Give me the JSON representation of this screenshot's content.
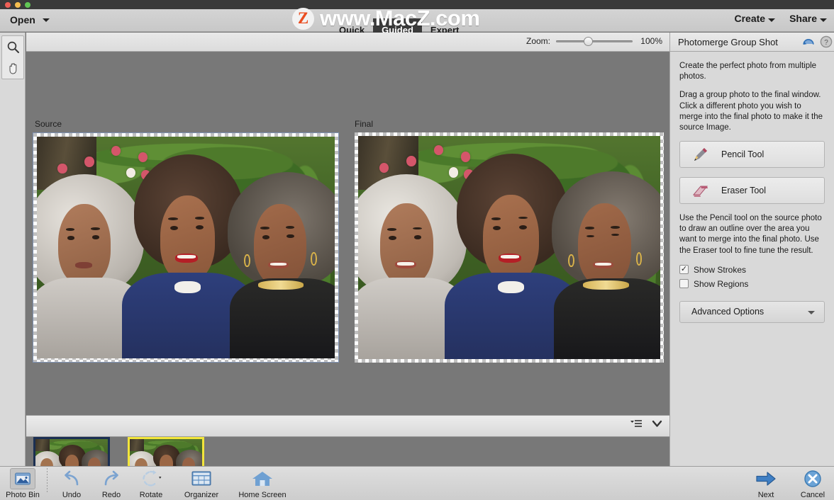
{
  "window": {
    "traffic_lights": [
      "close",
      "minimize",
      "zoom"
    ]
  },
  "menubar": {
    "open_label": "Open",
    "tabs": [
      {
        "label": "Quick",
        "active": false
      },
      {
        "label": "Guided",
        "active": true
      },
      {
        "label": "Expert",
        "active": false
      }
    ],
    "right_menus": [
      {
        "label": "Create"
      },
      {
        "label": "Share"
      }
    ]
  },
  "watermark": {
    "badge": "Z",
    "text": "www.MacZ.com"
  },
  "toolstrip": {
    "tools": [
      {
        "name": "zoom-tool",
        "icon": "magnifier-icon"
      },
      {
        "name": "hand-tool",
        "icon": "hand-icon"
      }
    ]
  },
  "options_bar": {
    "zoom_label": "Zoom:",
    "zoom_value": "100%",
    "slider_position_pct": 36
  },
  "canvas": {
    "source_label": "Source",
    "final_label": "Final"
  },
  "bin_bar": {
    "list_icon": "list-menu-icon",
    "chevron_icon": "chevron-down-icon"
  },
  "photo_bin": {
    "thumbnails": [
      {
        "name": "photo-thumbnail-1",
        "selected": false
      },
      {
        "name": "photo-thumbnail-2",
        "selected": true
      }
    ]
  },
  "right_panel": {
    "title": "Photomerge Group Shot",
    "header_icons": [
      {
        "name": "reset-icon"
      },
      {
        "name": "help-icon"
      }
    ],
    "intro_text": "Create the perfect photo from multiple photos.",
    "instructions_text": "Drag a group photo to the final window. Click a different photo you wish to merge into the final photo to make it the source Image.",
    "tools": [
      {
        "label": "Pencil Tool",
        "icon": "pencil-icon"
      },
      {
        "label": "Eraser Tool",
        "icon": "eraser-icon"
      }
    ],
    "usage_text": "Use the Pencil tool on the source photo to draw an outline over the area you want to merge into the final photo. Use the Eraser tool to fine tune the result.",
    "checkboxes": [
      {
        "label": "Show Strokes",
        "checked": true,
        "mark": "✓"
      },
      {
        "label": "Show Regions",
        "checked": false,
        "mark": ""
      }
    ],
    "advanced_label": "Advanced Options"
  },
  "bottom_bar": {
    "left_items": [
      {
        "label": "Photo Bin",
        "icon": "photo-bin-icon"
      },
      {
        "label": "Undo",
        "icon": "undo-icon"
      },
      {
        "label": "Redo",
        "icon": "redo-icon"
      },
      {
        "label": "Rotate",
        "icon": "rotate-icon"
      },
      {
        "label": "Organizer",
        "icon": "organizer-icon"
      },
      {
        "label": "Home Screen",
        "icon": "home-icon"
      }
    ],
    "right_items": [
      {
        "label": "Next",
        "icon": "arrow-right-icon"
      },
      {
        "label": "Cancel",
        "icon": "cancel-icon"
      }
    ]
  },
  "colors": {
    "canvas_bg": "#787878",
    "panel_bg": "#d9d9d9",
    "chrome_bg": "#c8c8c8",
    "accent_blue": "#2f6fb5",
    "selection_yellow": "#f2e53b",
    "watermark_orange": "#ea4d20"
  }
}
